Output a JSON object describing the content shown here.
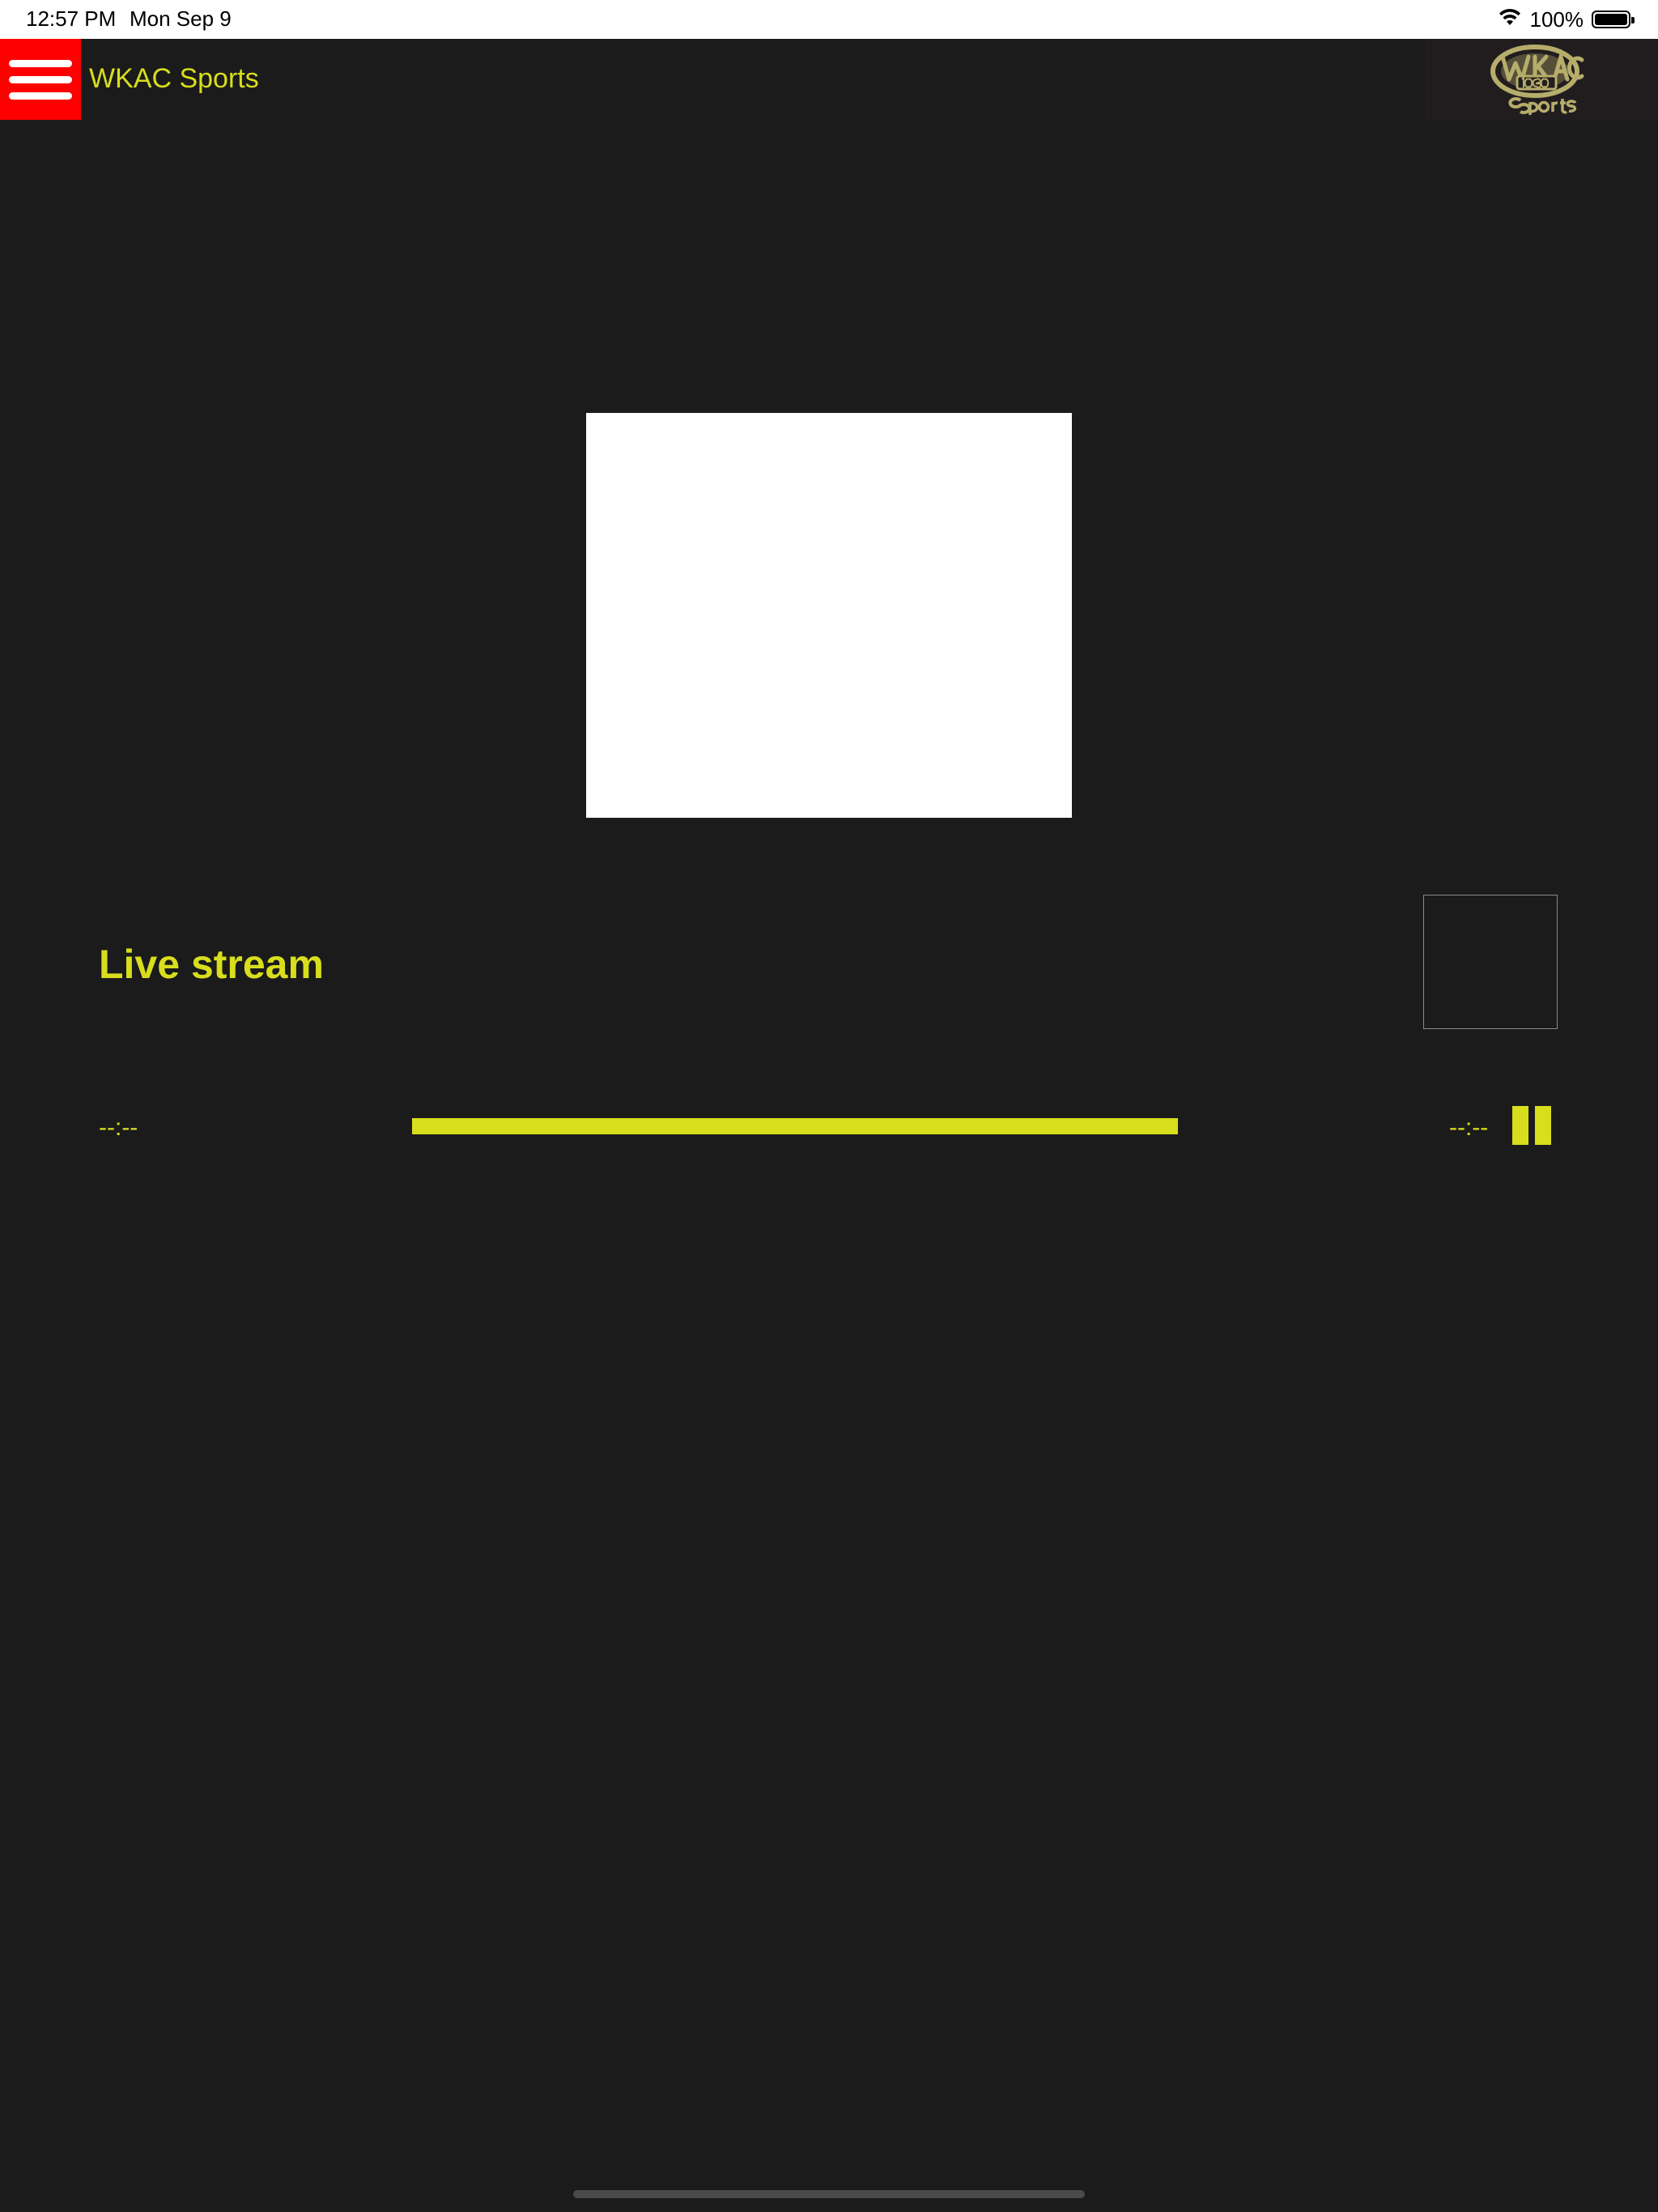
{
  "status_bar": {
    "time": "12:57 PM",
    "date": "Mon Sep 9",
    "battery_label": "100%",
    "battery_level": 1.0,
    "icons": [
      "wifi-icon",
      "battery-icon"
    ]
  },
  "header": {
    "menu_icon": "hamburger-menu-icon",
    "title": "WKAC Sports",
    "logo_text": "WKAC 1080 Sports",
    "menu_color": "#ff0000"
  },
  "player": {
    "artwork": "white-placeholder",
    "track_title": "Live stream",
    "elapsed": "--:--",
    "remaining": "--:--",
    "progress": 1.0,
    "state": "playing",
    "control_icon": "pause-icon"
  },
  "colors": {
    "background": "#1b1b1b",
    "accent": "#d8de1c",
    "menu": "#ff0000"
  }
}
